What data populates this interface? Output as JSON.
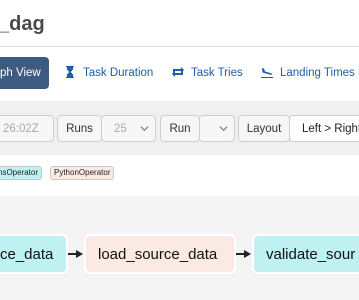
{
  "dag": {
    "title": "_dag"
  },
  "tabs": [
    {
      "label": "ph View",
      "icon": "graph-icon",
      "active": true
    },
    {
      "label": "Task Duration",
      "icon": "hourglass-icon"
    },
    {
      "label": "Task Tries",
      "icon": "retry-icon"
    },
    {
      "label": "Landing Times",
      "icon": "plane-landing-icon"
    }
  ],
  "toolbar": {
    "base_date": "26:02Z",
    "runs_label": "Runs",
    "runs_value": "25",
    "run_label": "Run",
    "run_value": "",
    "layout_label": "Layout",
    "layout_value": "Left > Right"
  },
  "legend": [
    {
      "label": "nsOperator",
      "color": "#bff0f2"
    },
    {
      "label": "PythonOperator",
      "color": "#fbeae4"
    }
  ],
  "graph": {
    "nodes": [
      {
        "label": "ce_data",
        "color": "#bff0f2"
      },
      {
        "label": "load_source_data",
        "color": "#fbeae4"
      },
      {
        "label": "validate_sour",
        "color": "#bff0f2"
      }
    ]
  },
  "colors": {
    "accent": "#3d5a80",
    "link": "#1f5fa8",
    "toolbar_bg": "#f0f0f0",
    "graph_bg": "#f4f4f4"
  }
}
